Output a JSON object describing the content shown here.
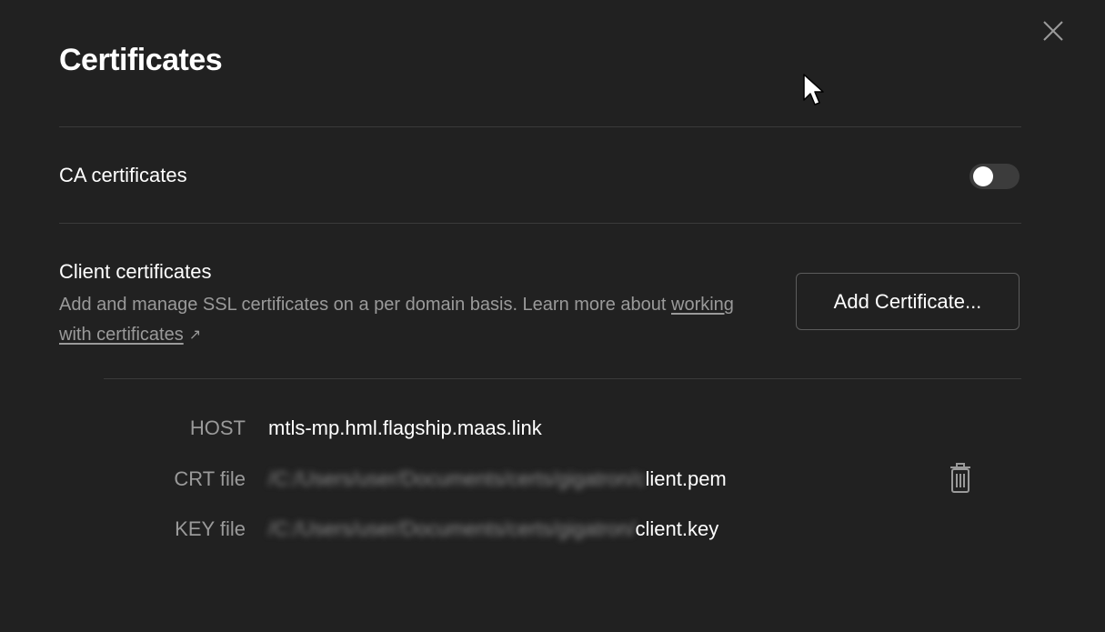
{
  "dialog": {
    "title": "Certificates",
    "close_icon": "close-icon"
  },
  "ca": {
    "label": "CA certificates",
    "toggle_on": false
  },
  "client": {
    "title": "Client certificates",
    "description_prefix": "Add and manage SSL certificates on a per domain basis. Learn more about ",
    "link_text": "working with certificates",
    "link_icon": "external-link-arrow-icon",
    "add_button_label": "Add Certificate..."
  },
  "certificate": {
    "host_label": "HOST",
    "host_value": "mtls-mp.hml.flagship.maas.link",
    "crt_label": "CRT file",
    "crt_path_blurred": "/C:/Users/user/Documents/certs/gigatron/c",
    "crt_path_visible": "lient.pem",
    "key_label": "KEY file",
    "key_path_blurred": "/C:/Users/user/Documents/certs/gigatron/",
    "key_path_visible": "client.key",
    "delete_icon": "trash-icon"
  },
  "colors": {
    "background": "#212121",
    "divider": "#3a3a3a",
    "muted_text": "#9a9a9a",
    "primary_text": "#ffffff"
  }
}
